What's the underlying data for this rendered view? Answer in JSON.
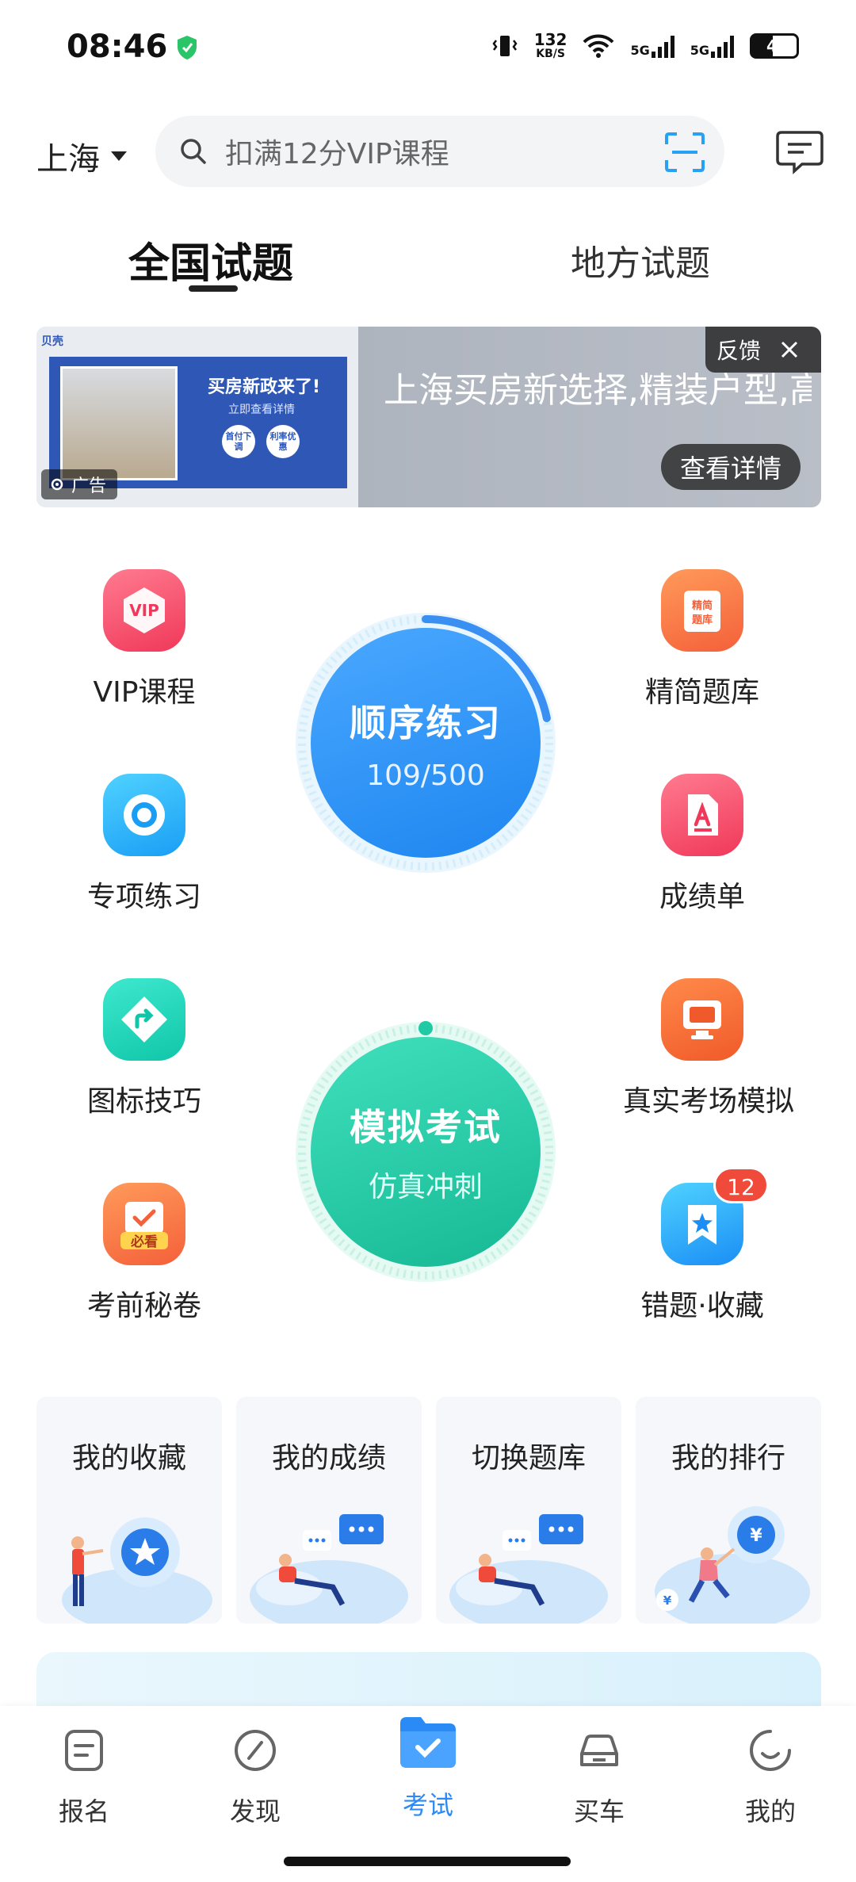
{
  "status_bar": {
    "time": "08:46",
    "speed_value": "132",
    "speed_unit": "KB/S",
    "net1": "5G",
    "net2": "5G",
    "battery": "42"
  },
  "header": {
    "city": "上海",
    "search_placeholder": "扣满12分VIP课程"
  },
  "tabs": {
    "active": "全国试题",
    "inactive": "地方试题"
  },
  "banner": {
    "ad_card_title": "买房新政来了!",
    "ad_card_sub": "立即查看详情",
    "pill1": "首付下调",
    "pill2": "利率优惠",
    "logo": "贝壳",
    "ad_tag": "广告",
    "headline": "上海买房新选择,精装户型,高品质低密,享受城市",
    "feedback": "反馈",
    "detail_button": "查看详情"
  },
  "features": {
    "vip": "VIP课程",
    "vip_icon_text": "VIP",
    "streamlined": "精简题库",
    "streamlined_icon_text": "精简题库",
    "special": "专项练习",
    "report": "成绩单",
    "icon_tips": "图标技巧",
    "simulation": "真实考场模拟",
    "secret": "考前秘卷",
    "secret_icon_text": "必看",
    "mistakes": "错题·收藏",
    "mistakes_badge": "12"
  },
  "sequential": {
    "title": "顺序练习",
    "progress_text": "109/500",
    "done": 109,
    "total": 500
  },
  "mock_exam": {
    "title": "模拟考试",
    "subtitle": "仿真冲刺"
  },
  "cards": {
    "favorites": "我的收藏",
    "scores": "我的成绩",
    "switch_bank": "切换题库",
    "ranking": "我的排行"
  },
  "nav": {
    "signup": "报名",
    "discover": "发现",
    "exam": "考试",
    "buy_car": "买车",
    "mine": "我的"
  },
  "colors": {
    "accent_blue": "#2a8af6",
    "mock_green": "#22c9a5",
    "badge_red": "#f04a3a"
  }
}
